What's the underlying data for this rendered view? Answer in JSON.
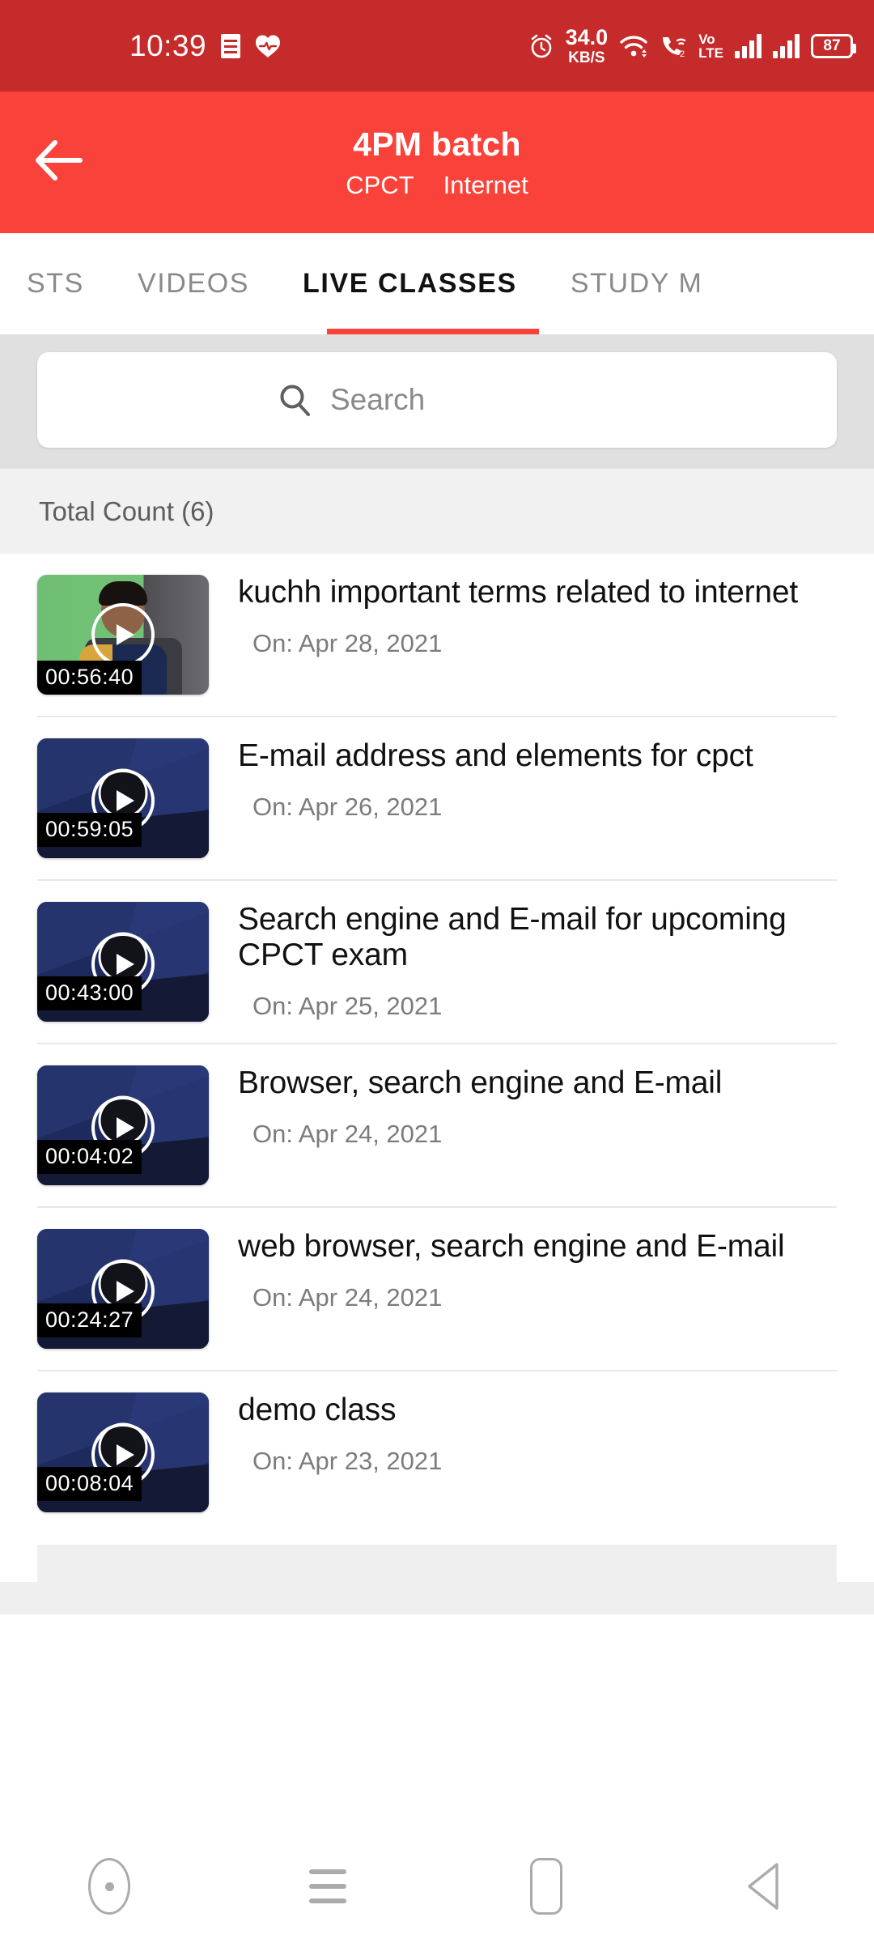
{
  "status_bar": {
    "time": "10:39",
    "network_speed_value": "34.0",
    "network_speed_unit": "KB/S",
    "volte_line1": "Vo",
    "volte_line2": "LTE",
    "battery_percent": "87",
    "icons": [
      "document-icon",
      "heart-icon",
      "alarm-icon",
      "wifi-icon",
      "call-wifi-icon",
      "volte-icon",
      "signal-bars-icon",
      "signal-bars-icon",
      "battery-icon"
    ],
    "bg_color": "#C62B2B"
  },
  "app_bar": {
    "back_icon": "back-arrow-icon",
    "title": "4PM batch",
    "subtitle_course": "CPCT",
    "subtitle_topic": "Internet",
    "bg_color": "#F9423A"
  },
  "tabs": {
    "items": [
      {
        "label": "STS",
        "active": false
      },
      {
        "label": "VIDEOS",
        "active": false
      },
      {
        "label": "LIVE CLASSES",
        "active": true
      },
      {
        "label": "STUDY M",
        "active": false
      }
    ],
    "indicator_color": "#F9423A"
  },
  "search": {
    "placeholder": "Search",
    "value": "",
    "icon": "search-icon"
  },
  "list_header": {
    "total_count_label": "Total Count (6)"
  },
  "classes": [
    {
      "title": "kuchh important terms related to internet",
      "date": "On: Apr 28, 2021",
      "duration": "00:56:40",
      "thumb_type": "photo"
    },
    {
      "title": "E-mail address and elements for cpct",
      "date": "On: Apr 26, 2021",
      "duration": "00:59:05",
      "thumb_type": "obs"
    },
    {
      "title": "Search engine and E-mail for upcoming CPCT exam",
      "date": "On: Apr 25, 2021",
      "duration": "00:43:00",
      "thumb_type": "obs"
    },
    {
      "title": "Browser, search engine and E-mail",
      "date": "On: Apr 24, 2021",
      "duration": "00:04:02",
      "thumb_type": "obs"
    },
    {
      "title": "web browser, search engine and E-mail",
      "date": "On: Apr 24, 2021",
      "duration": "00:24:27",
      "thumb_type": "obs"
    },
    {
      "title": "demo class",
      "date": "On: Apr 23, 2021",
      "duration": "00:08:04",
      "thumb_type": "obs"
    }
  ],
  "nav_bar": {
    "items": [
      "screen-record-icon",
      "menu-icon",
      "home-icon",
      "back-triangle-icon"
    ]
  }
}
